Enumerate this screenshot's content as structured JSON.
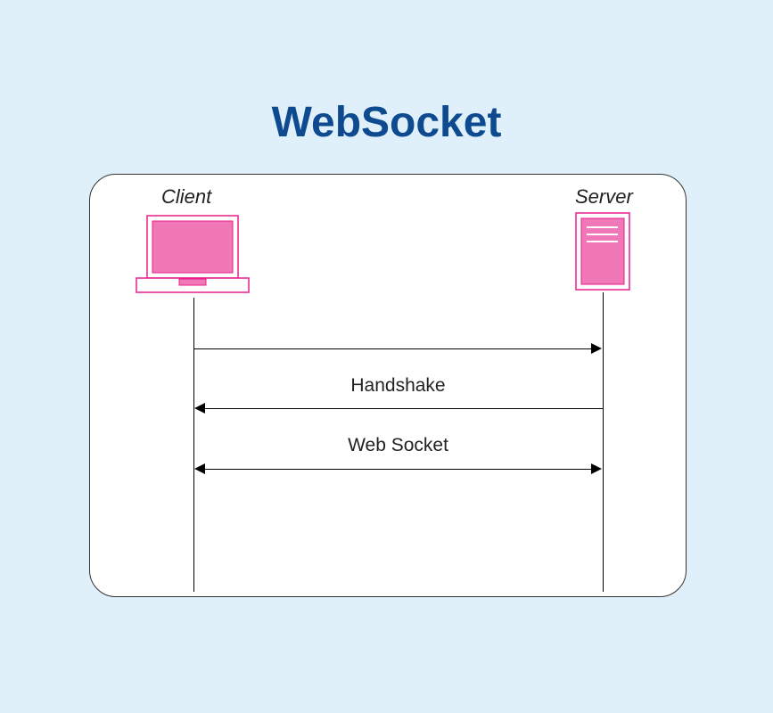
{
  "title": "WebSocket",
  "client_label": "Client",
  "server_label": "Server",
  "messages": {
    "handshake": "Handshake",
    "websocket": "Web Socket"
  },
  "colors": {
    "background": "#e0f0fa",
    "title": "#0d4a8f",
    "device_fill": "#f178b6",
    "device_stroke": "#e91e8c"
  }
}
